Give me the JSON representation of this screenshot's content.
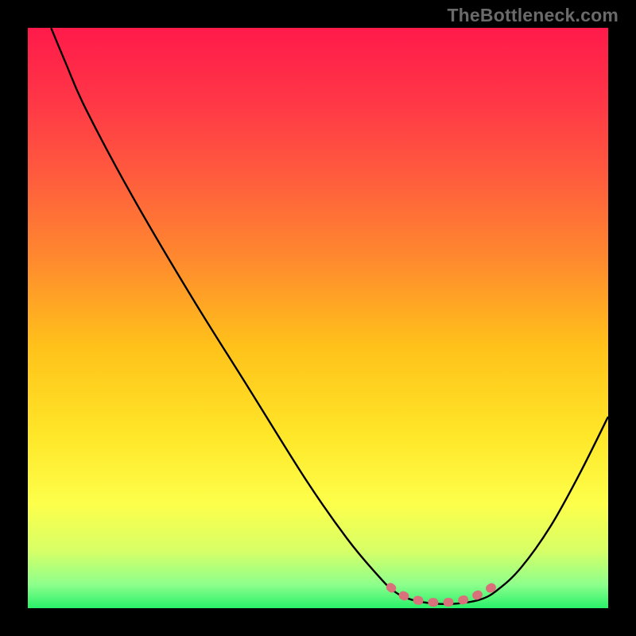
{
  "watermark": "TheBottleneck.com",
  "chart_data": {
    "type": "line",
    "title": "",
    "xlabel": "",
    "ylabel": "",
    "xlim": [
      0,
      100
    ],
    "ylim": [
      0,
      100
    ],
    "gradient_stops": [
      {
        "offset": 0,
        "color": "#ff1a4a"
      },
      {
        "offset": 12,
        "color": "#ff3547"
      },
      {
        "offset": 25,
        "color": "#ff5a3e"
      },
      {
        "offset": 40,
        "color": "#ff8a2e"
      },
      {
        "offset": 55,
        "color": "#ffc21a"
      },
      {
        "offset": 70,
        "color": "#ffe628"
      },
      {
        "offset": 82,
        "color": "#fdff4a"
      },
      {
        "offset": 90,
        "color": "#d8ff66"
      },
      {
        "offset": 96,
        "color": "#8cff8c"
      },
      {
        "offset": 100,
        "color": "#29f06a"
      }
    ],
    "series": [
      {
        "name": "bottleneck-curve",
        "color": "#000000",
        "points": [
          {
            "x": 4.0,
            "y": 100.0
          },
          {
            "x": 6.5,
            "y": 94.0
          },
          {
            "x": 10.0,
            "y": 86.0
          },
          {
            "x": 18.0,
            "y": 71.0
          },
          {
            "x": 28.0,
            "y": 54.0
          },
          {
            "x": 38.0,
            "y": 38.0
          },
          {
            "x": 48.0,
            "y": 22.0
          },
          {
            "x": 55.0,
            "y": 12.0
          },
          {
            "x": 60.0,
            "y": 6.0
          },
          {
            "x": 63.0,
            "y": 3.0
          },
          {
            "x": 66.0,
            "y": 1.5
          },
          {
            "x": 70.0,
            "y": 0.8
          },
          {
            "x": 74.0,
            "y": 0.8
          },
          {
            "x": 78.0,
            "y": 1.5
          },
          {
            "x": 81.0,
            "y": 3.2
          },
          {
            "x": 85.0,
            "y": 7.0
          },
          {
            "x": 90.0,
            "y": 14.0
          },
          {
            "x": 95.0,
            "y": 23.0
          },
          {
            "x": 100.0,
            "y": 33.0
          }
        ]
      },
      {
        "name": "optimal-band",
        "color": "#d9717b",
        "points": [
          {
            "x": 62.5,
            "y": 3.6
          },
          {
            "x": 64.0,
            "y": 2.5
          },
          {
            "x": 66.0,
            "y": 1.7
          },
          {
            "x": 68.0,
            "y": 1.2
          },
          {
            "x": 70.0,
            "y": 1.0
          },
          {
            "x": 72.0,
            "y": 1.0
          },
          {
            "x": 74.0,
            "y": 1.2
          },
          {
            "x": 76.0,
            "y": 1.7
          },
          {
            "x": 78.0,
            "y": 2.5
          },
          {
            "x": 80.0,
            "y": 3.6
          }
        ]
      }
    ]
  }
}
